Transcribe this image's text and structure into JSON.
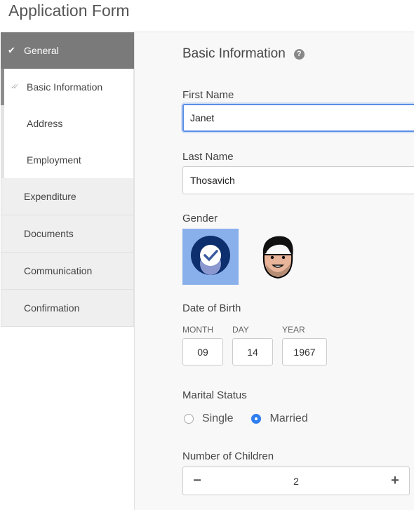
{
  "app_title": "Application Form",
  "sidebar": {
    "section": {
      "label": "General",
      "icon": "check-icon"
    },
    "sub_items": [
      {
        "label": "Basic Information",
        "icon": "double-check-icon",
        "active": true
      },
      {
        "label": "Address"
      },
      {
        "label": "Employment"
      }
    ],
    "items": [
      {
        "label": "Expenditure"
      },
      {
        "label": "Documents"
      },
      {
        "label": "Communication"
      },
      {
        "label": "Confirmation"
      }
    ]
  },
  "main": {
    "section_title": "Basic Information",
    "help_icon": "?",
    "first_name": {
      "label": "First Name",
      "value": "Janet"
    },
    "last_name": {
      "label": "Last Name",
      "value": "Thosavich"
    },
    "gender": {
      "label": "Gender",
      "options": [
        {
          "name": "female",
          "selected": true
        },
        {
          "name": "male",
          "selected": false
        }
      ]
    },
    "dob": {
      "label": "Date of Birth",
      "month_label": "MONTH",
      "month": "09",
      "day_label": "DAY",
      "day": "14",
      "year_label": "YEAR",
      "year": "1967"
    },
    "marital": {
      "label": "Marital Status",
      "options": [
        "Single",
        "Married"
      ],
      "selected": "Married"
    },
    "children": {
      "label": "Number of Children",
      "value": "2",
      "minus": "−",
      "plus": "+"
    }
  },
  "colors": {
    "accent": "#2f7ff0",
    "focus": "#5b8fe6",
    "selected_bg": "#8ab0ec",
    "sidebar_active": "#7a7a7a"
  }
}
